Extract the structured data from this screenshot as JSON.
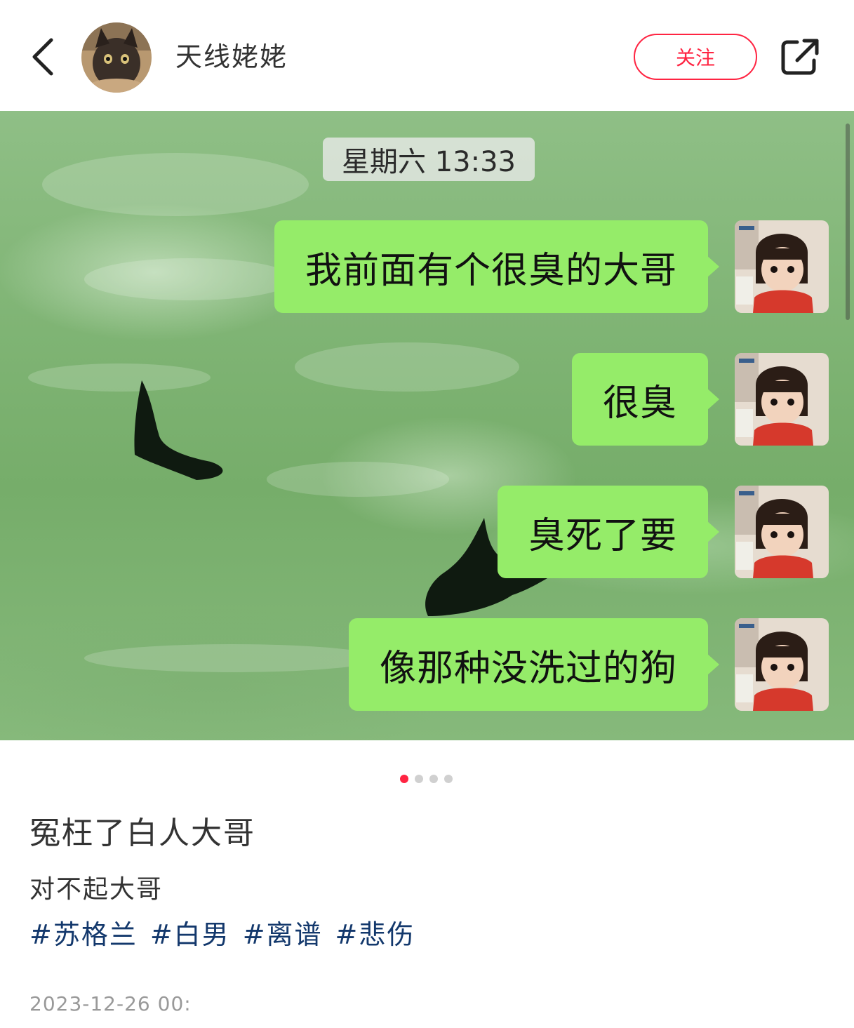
{
  "header": {
    "username": "天线姥姥",
    "follow_label": "关注"
  },
  "chat": {
    "timestamp": "星期六 13:33",
    "messages": [
      "我前面有个很臭的大哥",
      "很臭",
      "臭死了要",
      "像那种没洗过的狗"
    ]
  },
  "carousel": {
    "total": 4,
    "current": 1
  },
  "post": {
    "title": "冤枉了白人大哥",
    "description": "对不起大哥",
    "tags": [
      "#苏格兰",
      "#白男",
      "#离谱",
      "#悲伤"
    ],
    "date": "2023-12-26 00:"
  },
  "colors": {
    "accent": "#ff2442",
    "tag": "#13386c",
    "bubble": "#95ec69"
  },
  "icons": {
    "back": "chevron-left-icon",
    "share": "share-icon"
  }
}
